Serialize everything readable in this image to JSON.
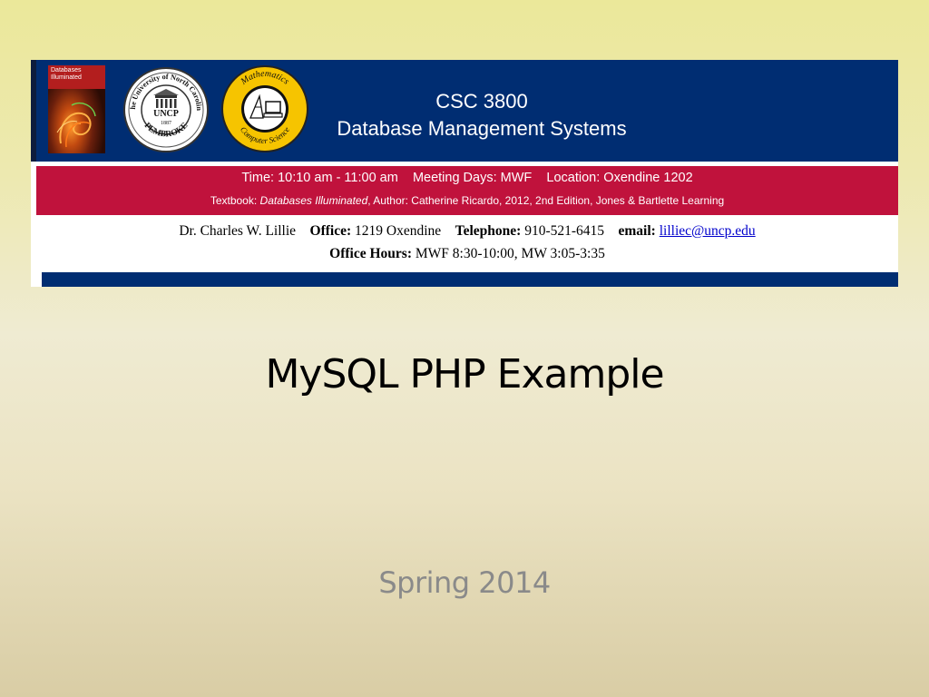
{
  "banner": {
    "book": {
      "title": "Databases\nIlluminated",
      "icon": "book-cover-icon"
    },
    "university_seal": {
      "arc_top": "The University of North Carolina",
      "center": "UNCP",
      "year": "1887",
      "bottom": "PEMBROKE",
      "icon": "university-seal-icon"
    },
    "dept_seal": {
      "top": "Mathematics",
      "bottom": "Computer Science",
      "icon": "math-cs-seal-icon"
    },
    "course_code": "CSC 3800",
    "course_name": "Database Management Systems",
    "schedule": {
      "time_label": "Time:",
      "time_value": "10:10 am - 11:00 am",
      "days_label": "Meeting Days:",
      "days_value": "MWF",
      "location_label": "Location:",
      "location_value": "Oxendine 1202"
    },
    "textbook": {
      "label": "Textbook:",
      "title": "Databases Illuminated",
      "details": ", Author: Catherine Ricardo, 2012, 2nd Edition, Jones & Bartlette Learning"
    },
    "instructor": {
      "name": "Dr. Charles W. Lillie",
      "office_label": "Office:",
      "office_value": "1219 Oxendine",
      "telephone_label": "Telephone:",
      "telephone_value": "910-521-6415",
      "email_label": "email:",
      "email_value": "lilliec@uncp.edu",
      "hours_label": "Office Hours:",
      "hours_value": "MWF 8:30-10:00, MW 3:05-3:35"
    },
    "colors": {
      "navy": "#002d72",
      "crimson": "#c0123c",
      "gold": "#f6c400"
    }
  },
  "slide": {
    "title": "MySQL PHP Example",
    "subtitle": "Spring 2014"
  }
}
